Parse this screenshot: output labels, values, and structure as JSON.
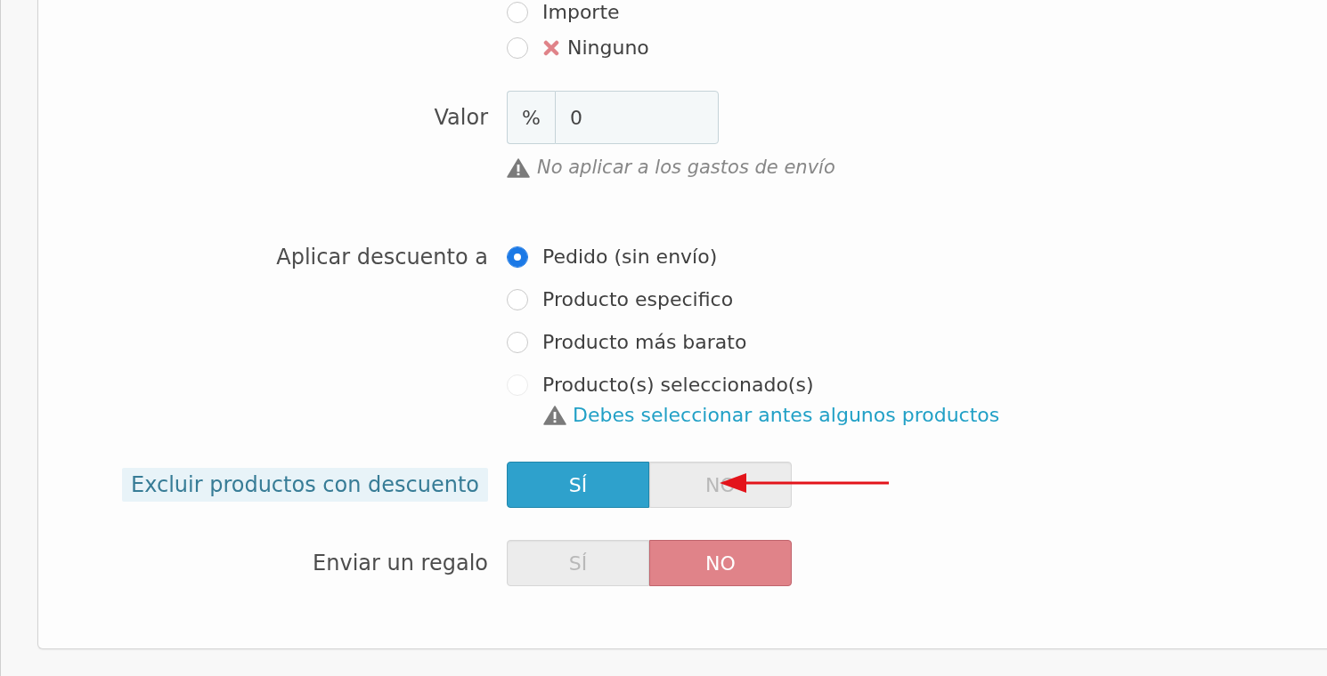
{
  "discount_type": {
    "options": [
      {
        "label": "Importe",
        "selected": false,
        "kind": "plain"
      },
      {
        "label": "Ninguno",
        "selected": false,
        "kind": "cross"
      }
    ]
  },
  "value": {
    "label": "Valor",
    "addon": "%",
    "value": "0",
    "help": "No aplicar a los gastos de envío"
  },
  "apply_discount": {
    "label": "Aplicar descuento a",
    "options": [
      {
        "label": "Pedido (sin envío)",
        "selected": true,
        "disabled": false
      },
      {
        "label": "Producto especifico",
        "selected": false,
        "disabled": false
      },
      {
        "label": "Producto más barato",
        "selected": false,
        "disabled": false
      },
      {
        "label": "Producto(s) seleccionado(s)",
        "selected": false,
        "disabled": true
      }
    ],
    "warning": "Debes seleccionar antes algunos productos"
  },
  "switches": [
    {
      "label": "Excluir productos con descuento",
      "highlighted": true,
      "arrow": true,
      "options": [
        {
          "label": "SÍ",
          "kind": "yes",
          "selected": true
        },
        {
          "label": "NO",
          "kind": "no",
          "selected": false
        }
      ]
    },
    {
      "label": "Enviar un regalo",
      "highlighted": false,
      "arrow": false,
      "options": [
        {
          "label": "SÍ",
          "kind": "yes",
          "selected": false
        },
        {
          "label": "NO",
          "kind": "no",
          "selected": true
        }
      ]
    }
  ]
}
